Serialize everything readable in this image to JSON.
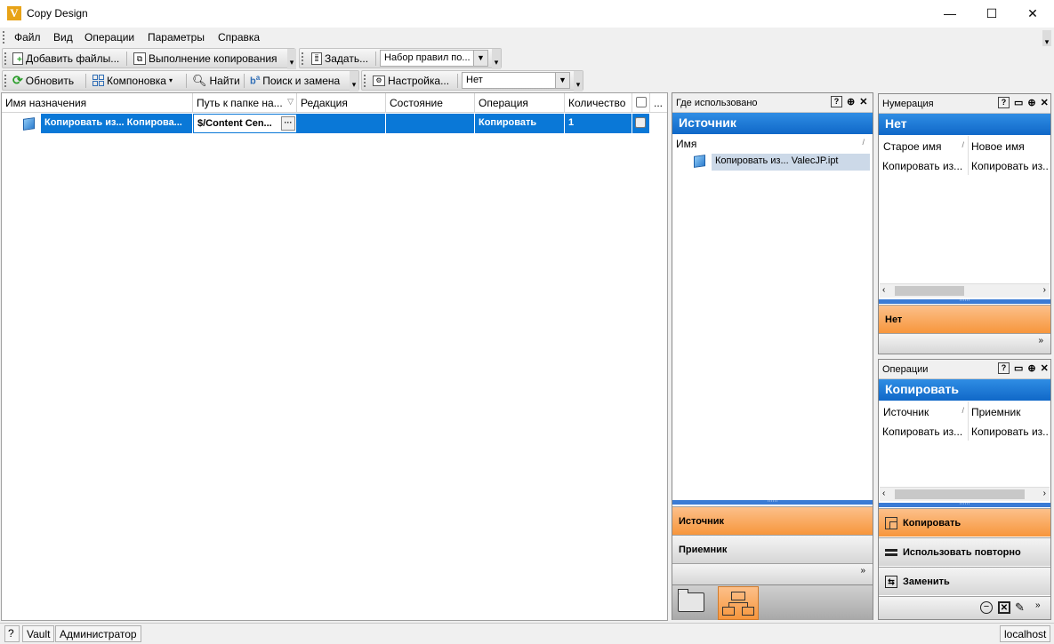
{
  "window": {
    "title": "Copy Design",
    "app_icon": "V",
    "minimize": "—",
    "maximize": "☐",
    "close": "✕"
  },
  "menu": {
    "items": [
      "Файл",
      "Вид",
      "Операции",
      "Параметры",
      "Справка"
    ]
  },
  "toolbar1": {
    "add_files": "Добавить файлы...",
    "run_copy": "Выполнение копирования",
    "set": "Задать...",
    "ruleset": "Набор правил по..."
  },
  "toolbar2": {
    "refresh": "Обновить",
    "layout": "Компоновка",
    "find": "Найти",
    "find_replace": "Поиск и замена",
    "settings": "Настройка...",
    "combo_value": "Нет"
  },
  "grid": {
    "columns": [
      "Имя назначения",
      "Путь к папке на...",
      "Редакция",
      "Состояние",
      "Операция",
      "Количество",
      "",
      "..."
    ],
    "row": {
      "name": "Копировать из... Копирова...",
      "path": "$/Content Cen...",
      "path_btn": "···",
      "revision": "",
      "state": "",
      "operation": "Копировать",
      "quantity": "1"
    }
  },
  "where_used": {
    "title": "Где использовано",
    "header": "Источник",
    "col_name": "Имя",
    "item": "Копировать из... ValecJP.ipt",
    "nav": [
      "Источник",
      "Приемник"
    ],
    "help": "?",
    "pin": "⊕",
    "close": "✕"
  },
  "numbering": {
    "title": "Нумерация",
    "header": "Нет",
    "col_old": "Старое имя",
    "col_new": "Новое имя",
    "row_old": "Копировать из...",
    "row_new": "Копировать из...",
    "nav": "Нет"
  },
  "operations": {
    "title": "Операции",
    "header": "Копировать",
    "col_src": "Источник",
    "col_dst": "Приемник",
    "row_src": "Копировать из...",
    "row_dst": "Копировать из...",
    "nav": [
      "Копировать",
      "Использовать повторно",
      "Заменить"
    ]
  },
  "status": {
    "help": "?",
    "vault": "Vault",
    "user": "Администратор",
    "server": "localhost"
  },
  "colors": {
    "accent_blue": "#0a78d7",
    "nav_orange": "#f7963c"
  }
}
